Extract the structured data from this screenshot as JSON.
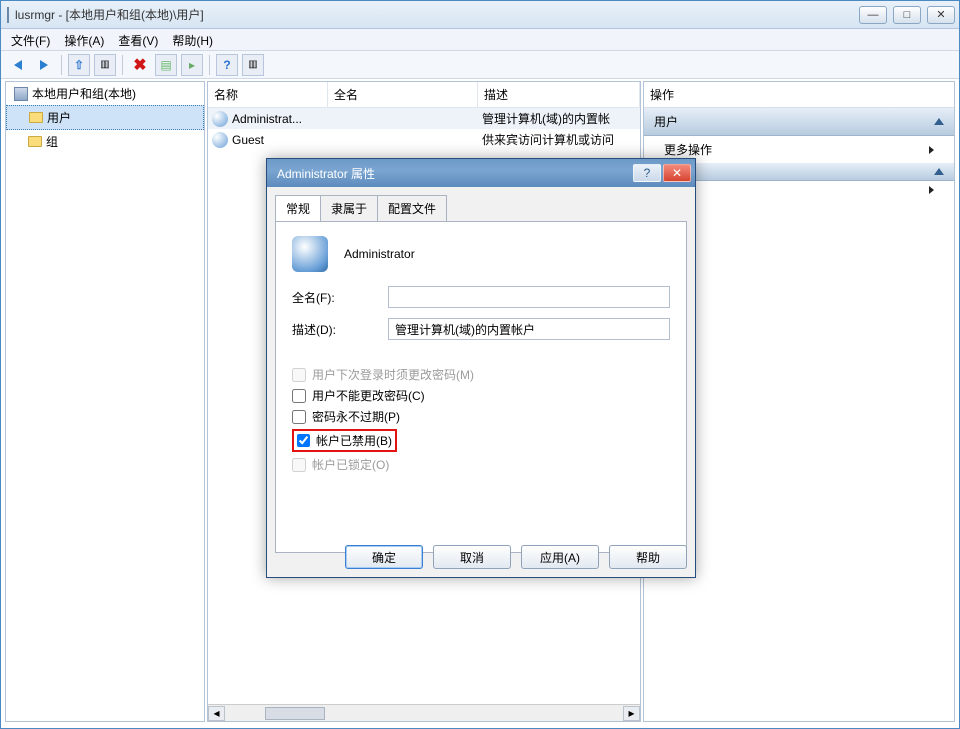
{
  "window": {
    "title": "lusrmgr - [本地用户和组(本地)\\用户]",
    "minimize": "—",
    "maximize": "□",
    "close": "✕"
  },
  "menubar": {
    "file": "文件(F)",
    "action": "操作(A)",
    "view": "查看(V)",
    "help": "帮助(H)"
  },
  "tree": {
    "root": "本地用户和组(本地)",
    "users": "用户",
    "groups": "组"
  },
  "columns": {
    "name": "名称",
    "fullname": "全名",
    "desc": "描述"
  },
  "rows": {
    "r0": {
      "name": "Administrat...",
      "fullname": "",
      "desc": "管理计算机(域)的内置帐"
    },
    "r1": {
      "name": "Guest",
      "fullname": "",
      "desc": "供来宾访问计算机或访问"
    }
  },
  "actions": {
    "header": "操作",
    "users": "用户",
    "more": "更多操作"
  },
  "dialog": {
    "title": "Administrator 属性",
    "help": "?",
    "close": "✕",
    "tabs": {
      "general": "常规",
      "memberof": "隶属于",
      "profile": "配置文件"
    },
    "username": "Administrator",
    "fullname_label": "全名(F):",
    "fullname_value": "",
    "desc_label": "描述(D):",
    "desc_value": "管理计算机(域)的内置帐户",
    "chk_mustchange": "用户下次登录时须更改密码(M)",
    "chk_cannotchange": "用户不能更改密码(C)",
    "chk_neverexpire": "密码永不过期(P)",
    "chk_disabled": "帐户已禁用(B)",
    "chk_locked": "帐户已锁定(O)",
    "btn_ok": "确定",
    "btn_cancel": "取消",
    "btn_apply": "应用(A)",
    "btn_help": "帮助"
  }
}
